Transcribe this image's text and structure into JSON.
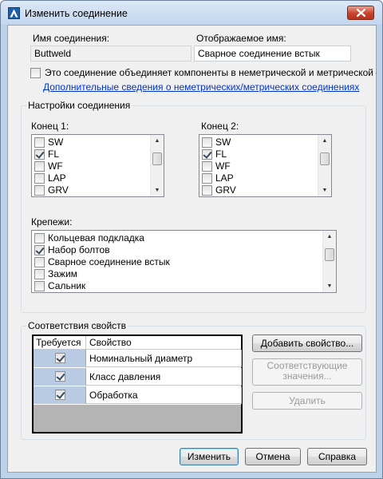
{
  "window": {
    "title": "Изменить соединение"
  },
  "connection_name": {
    "label": "Имя соединения:",
    "value": "Buttweld"
  },
  "display_name": {
    "label": "Отображаемое имя:",
    "value": "Сварное соединение встык"
  },
  "mixed_units": {
    "label": "Это соединение объединяет компоненты в неметрической и метрической систем",
    "checked": false,
    "link": "Дополнительные сведения о неметрических/метрических соединениях"
  },
  "connection_settings": {
    "title": "Настройки соединения",
    "end1": {
      "label": "Конец 1:",
      "items": [
        {
          "label": "SW",
          "checked": false
        },
        {
          "label": "FL",
          "checked": true
        },
        {
          "label": "WF",
          "checked": false
        },
        {
          "label": "LAP",
          "checked": false
        },
        {
          "label": "GRV",
          "checked": false
        }
      ]
    },
    "end2": {
      "label": "Конец 2:",
      "items": [
        {
          "label": "SW",
          "checked": false
        },
        {
          "label": "FL",
          "checked": true
        },
        {
          "label": "WF",
          "checked": false
        },
        {
          "label": "LAP",
          "checked": false
        },
        {
          "label": "GRV",
          "checked": false
        }
      ]
    },
    "fasteners": {
      "label": "Крепежи:",
      "items": [
        {
          "label": "Кольцевая подкладка",
          "checked": false
        },
        {
          "label": "Набор болтов",
          "checked": true
        },
        {
          "label": "Сварное соединение встык",
          "checked": false
        },
        {
          "label": "Зажим",
          "checked": false
        },
        {
          "label": "Сальник",
          "checked": false
        }
      ]
    }
  },
  "property_mapping": {
    "title": "Соответствия свойств",
    "columns": [
      "Требуется",
      "Свойство"
    ],
    "rows": [
      {
        "required": true,
        "property": "Номинальный диаметр"
      },
      {
        "required": true,
        "property": "Класс давления"
      },
      {
        "required": true,
        "property": "Обработка"
      }
    ],
    "add_button": "Добавить свойство...",
    "matching_button": [
      "Соответствующие",
      "значения..."
    ],
    "delete_button": "Удалить"
  },
  "footer": {
    "edit_button": "Изменить",
    "cancel_button": "Отмена",
    "help_button": "Справка"
  }
}
